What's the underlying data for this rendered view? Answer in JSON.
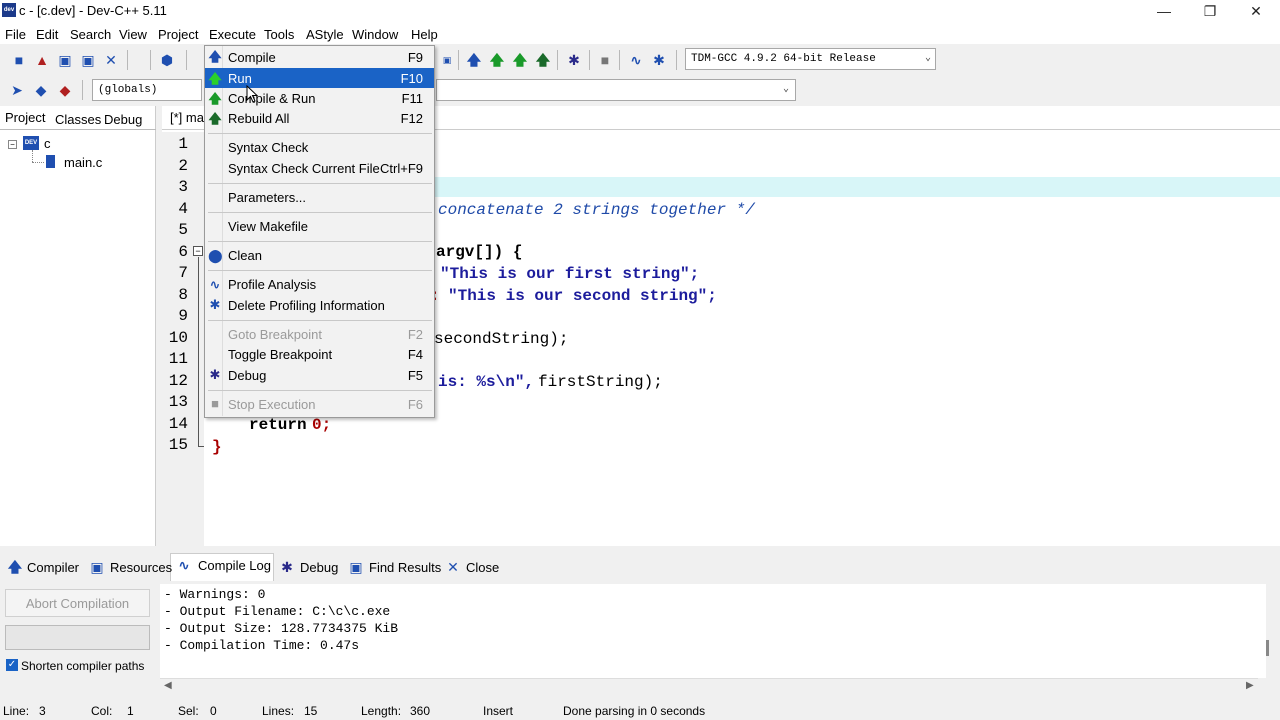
{
  "window": {
    "title": "c - [c.dev] - Dev-C++ 5.11",
    "app_icon_text": "dev",
    "controls": {
      "minimize": "—",
      "maximize": "❐",
      "close": "✕"
    }
  },
  "menubar": [
    "File",
    "Edit",
    "Search",
    "View",
    "Project",
    "Execute",
    "Tools",
    "AStyle",
    "Window",
    "Help"
  ],
  "toolbar": {
    "compiler_select": "TDM-GCC 4.9.2 64-bit Release",
    "scope_select": "(globals)"
  },
  "project_panel": {
    "tabs": [
      "Project",
      "Classes",
      "Debug"
    ],
    "tree": {
      "root": "c",
      "child": "main.c",
      "root_icon_text": "DEV"
    }
  },
  "editor": {
    "tab_label": "[*] ma",
    "line_numbers": [
      "1",
      "2",
      "3",
      "4",
      "5",
      "6",
      "7",
      "8",
      "9",
      "10",
      "11",
      "12",
      "13",
      "14",
      "15"
    ],
    "visible_code": {
      "line4": "concatenate 2 strings together */",
      "line6a": "argv[]) {",
      "line7": "\"This is our first string\";",
      "line8a": ": ",
      "line8b": "\"This is our second string\";",
      "line10": "secondString);",
      "line12a": "is: %s\\n\", ",
      "line12b": "firstString);",
      "line14a": "return ",
      "line14b": "0;",
      "line15": "}"
    }
  },
  "execute_menu": {
    "items": [
      {
        "label": "Compile",
        "shortcut": "F9"
      },
      {
        "label": "Run",
        "shortcut": "F10"
      },
      {
        "label": "Compile & Run",
        "shortcut": "F11"
      },
      {
        "label": "Rebuild All",
        "shortcut": "F12"
      },
      {
        "label": "Syntax Check",
        "shortcut": ""
      },
      {
        "label": "Syntax Check Current File",
        "shortcut": "Ctrl+F9"
      },
      {
        "label": "Parameters...",
        "shortcut": ""
      },
      {
        "label": "View Makefile",
        "shortcut": ""
      },
      {
        "label": "Clean",
        "shortcut": ""
      },
      {
        "label": "Profile Analysis",
        "shortcut": ""
      },
      {
        "label": "Delete Profiling Information",
        "shortcut": ""
      },
      {
        "label": "Goto Breakpoint",
        "shortcut": "F2"
      },
      {
        "label": "Toggle Breakpoint",
        "shortcut": "F4"
      },
      {
        "label": "Debug",
        "shortcut": "F5"
      },
      {
        "label": "Stop Execution",
        "shortcut": "F6"
      }
    ],
    "highlighted": "Run"
  },
  "bottom_panel": {
    "tabs": [
      "Compiler",
      "Resources",
      "Compile Log",
      "Debug",
      "Find Results",
      "Close"
    ],
    "active_tab": "Compile Log",
    "abort_button": "Abort Compilation",
    "shorten_paths_label": "Shorten compiler paths",
    "shorten_paths_checked": true,
    "log_lines": [
      "- Warnings: 0",
      "- Output Filename: C:\\c\\c.exe",
      "- Output Size: 128.7734375 KiB",
      "- Compilation Time: 0.47s"
    ]
  },
  "statusbar": {
    "line_label": "Line:",
    "line": "3",
    "col_label": "Col:",
    "col": "1",
    "sel_label": "Sel:",
    "sel": "0",
    "lines_label": "Lines:",
    "lines": "15",
    "length_label": "Length:",
    "length": "360",
    "mode": "Insert",
    "message": "Done parsing in 0 seconds"
  },
  "colors": {
    "menu_highlight": "#1a63c6",
    "keyword": "#000000",
    "string": "#1c1c9c",
    "comment": "#1f4aa8",
    "bracket": "#a80000",
    "current_line": "#d8f6f8"
  }
}
